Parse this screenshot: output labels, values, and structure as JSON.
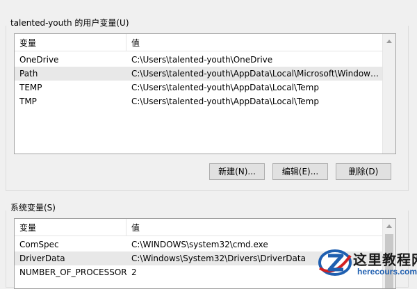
{
  "user_vars": {
    "group_title": "talented-youth 的用户变量(U)",
    "header": {
      "name": "变量",
      "value": "值"
    },
    "rows": [
      {
        "name": "OneDrive",
        "value": "C:\\Users\\talented-youth\\OneDrive"
      },
      {
        "name": "Path",
        "value": "C:\\Users\\talented-youth\\AppData\\Local\\Microsoft\\WindowsA..."
      },
      {
        "name": "TEMP",
        "value": "C:\\Users\\talented-youth\\AppData\\Local\\Temp"
      },
      {
        "name": "TMP",
        "value": "C:\\Users\\talented-youth\\AppData\\Local\\Temp"
      }
    ],
    "buttons": {
      "new": "新建(N)...",
      "edit": "编辑(E)...",
      "delete": "删除(D)"
    }
  },
  "system_vars": {
    "group_title": "系统变量(S)",
    "header": {
      "name": "变量",
      "value": "值"
    },
    "rows": [
      {
        "name": "ComSpec",
        "value": "C:\\WINDOWS\\system32\\cmd.exe"
      },
      {
        "name": "DriverData",
        "value": "C:\\Windows\\System32\\Drivers\\DriverData"
      },
      {
        "name": "NUMBER_OF_PROCESSORS",
        "value": "2"
      }
    ]
  },
  "watermark": {
    "text_cn": "这里教程网",
    "text_en": "herecours.com",
    "icon": "z-logo-icon"
  },
  "colors": {
    "selected_row": "#e8e8e8",
    "background": "#f0f0f0",
    "watermark_blue": "#1f5fb0",
    "watermark_red": "#d32020"
  }
}
